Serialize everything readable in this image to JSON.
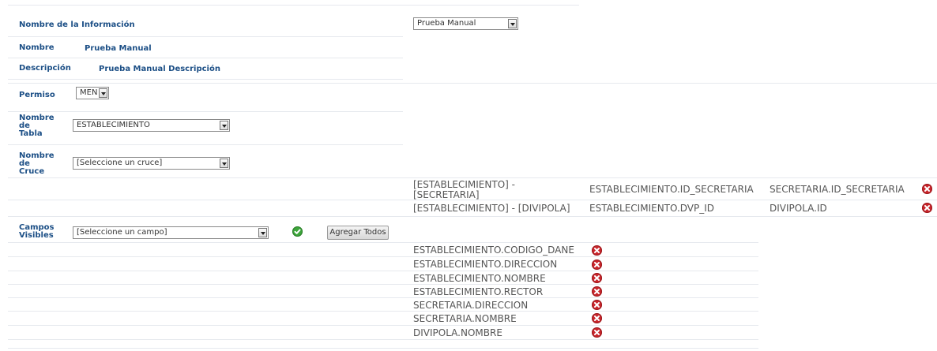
{
  "info": {
    "label": "Nombre de la Información",
    "select_value": "Prueba Manual"
  },
  "nombre": {
    "label": "Nombre",
    "value": "Prueba Manual"
  },
  "descripcion": {
    "label": "Descripción",
    "value": "Prueba Manual Descripción"
  },
  "permiso": {
    "label": "Permiso",
    "select_value": "MEN"
  },
  "tabla": {
    "label_l1": "Nombre",
    "label_l2": "de",
    "label_l3": "Tabla",
    "select_value": "ESTABLECIMIENTO"
  },
  "cruce": {
    "label_l1": "Nombre",
    "label_l2": "de",
    "label_l3": "Cruce",
    "select_value": "[Seleccione un cruce]"
  },
  "cruces": [
    {
      "tables_l1": "[ESTABLECIMIENTO] -",
      "tables_l2": "[SECRETARIA]",
      "field_a": "ESTABLECIMIENTO.ID_SECRETARIA",
      "field_b": "SECRETARIA.ID_SECRETARIA"
    },
    {
      "tables_l1": "[ESTABLECIMIENTO] - [DIVIPOLA]",
      "tables_l2": "",
      "field_a": "ESTABLECIMIENTO.DVP_ID",
      "field_b": "DIVIPOLA.ID"
    }
  ],
  "campos": {
    "label_l1": "Campos",
    "label_l2": "Visibles",
    "select_value": "[Seleccione un campo]",
    "add_all_label": "Agregar Todos"
  },
  "campos_list": [
    "ESTABLECIMIENTO.CODIGO_DANE",
    "ESTABLECIMIENTO.DIRECCION",
    "ESTABLECIMIENTO.NOMBRE",
    "ESTABLECIMIENTO.RECTOR",
    "SECRETARIA.DIRECCION",
    "SECRETARIA.NOMBRE",
    "DIVIPOLA.NOMBRE"
  ]
}
